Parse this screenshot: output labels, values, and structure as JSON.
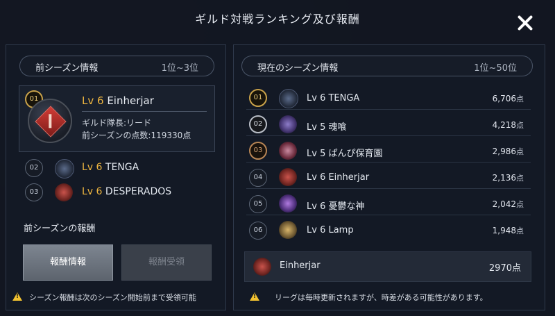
{
  "title": "ギルド対戦ランキング及び報酬",
  "left": {
    "header_label": "前シーズン情報",
    "header_range": "1位~3位",
    "featured": {
      "rank": "01",
      "level": "Lv 6",
      "name": "Einherjar",
      "leader": "ギルド隊長:リード",
      "points": "前シーズンの点数:119330点"
    },
    "rows": [
      {
        "rank": "02",
        "level": "Lv 6",
        "name": "TENGA"
      },
      {
        "rank": "03",
        "level": "Lv 6",
        "name": "DESPERADOS"
      }
    ],
    "reward_title": "前シーズンの報酬",
    "reward_info_button": "報酬情報",
    "reward_claim_button": "報酬受領",
    "note": "シーズン報酬は次のシーズン開始前まで受領可能"
  },
  "right": {
    "header_label": "現在のシーズン情報",
    "header_range": "1位~50位",
    "rows": [
      {
        "rank": "01",
        "name": "Lv 6 TENGA",
        "score": "6,706",
        "unit": "点"
      },
      {
        "rank": "02",
        "name": "Lv 5 魂喰",
        "score": "4,218",
        "unit": "点"
      },
      {
        "rank": "03",
        "name": "Lv 5 ぱんぴ保育園",
        "score": "2,986",
        "unit": "点"
      },
      {
        "rank": "04",
        "name": "Lv 6 Einherjar",
        "score": "2,136",
        "unit": "点"
      },
      {
        "rank": "05",
        "name": "Lv 6 憂鬱な神",
        "score": "2,042",
        "unit": "点"
      },
      {
        "rank": "06",
        "name": "Lv 6 Lamp",
        "score": "1,948",
        "unit": "点"
      }
    ],
    "my_guild": {
      "name": "Einherjar",
      "score": "2970点"
    },
    "note": "リーグは毎時更新されますが、時差がある可能性があります。"
  },
  "colors": {
    "level_accent": "#f0b740",
    "rank_gold": "#c9a24a",
    "rank_silver": "#b9bec7",
    "rank_bronze": "#b98655",
    "warning": "#f2c230"
  },
  "icons": [
    "close-icon",
    "warning-icon",
    "guild-emblem-icon"
  ]
}
